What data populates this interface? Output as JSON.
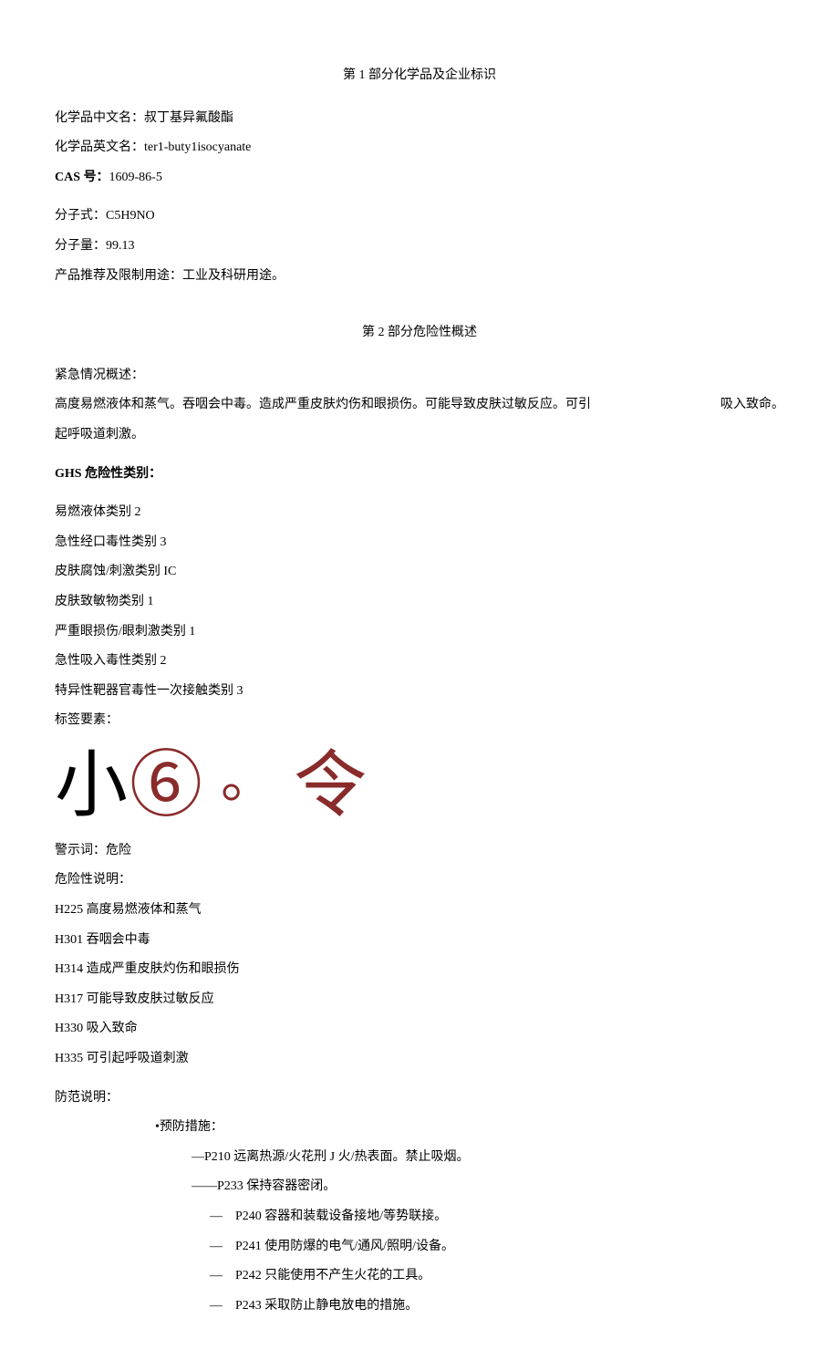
{
  "section1": {
    "title": "第 1 部分化学品及企业标识",
    "name_cn_label": "化学品中文名：",
    "name_cn_value": "叔丁基异氟酸酯",
    "name_en_label": "化学品英文名：",
    "name_en_value": "ter1-buty1isocyanate",
    "cas_label": "CAS 号：",
    "cas_value": "1609-86-5",
    "formula_label": "分子式：",
    "formula_value": "C5H9NO",
    "mw_label": "分子量：",
    "mw_value": "99.13",
    "use_label": "产品推荐及限制用途：",
    "use_value": "工业及科研用途。"
  },
  "section2": {
    "title": "第 2 部分危险性概述",
    "emergency_label": "紧急情况概述：",
    "emergency_text_left": "高度易燃液体和蒸气。吞咽会中毒。造成严重皮肤灼伤和眼损伤。可能导致皮肤过敏反应。可引",
    "emergency_text_right": "吸入致命。",
    "emergency_text_line2": "起呼吸道刺激。",
    "ghs_label": "GHS 危险性类别：",
    "ghs_classes": [
      "易燃液体类别 2",
      "急性经口毒性类别 3",
      "皮肤腐蚀/刺激类别 IC",
      "皮肤致敏物类别 1",
      "严重眼损伤/眼刺激类别 1",
      "急性吸入毒性类别 2",
      "特异性靶器官毒性一次接触类别 3"
    ],
    "label_elements": "标签要素：",
    "pictograms": {
      "p1": "小",
      "p2": "⑥",
      "p3": "。",
      "p4": "令"
    },
    "signal_label": "警示词：",
    "signal_value": "危险",
    "hazard_label": "危险性说明：",
    "hazard_statements": [
      "H225 高度易燃液体和蒸气",
      "H301 吞咽会中毒",
      "H314 造成严重皮肤灼伤和眼损伤",
      "H317 可能导致皮肤过敏反应",
      "H330 吸入致命",
      "H335 可引起呼吸道刺激"
    ],
    "precaution_label": "防范说明：",
    "prevention_header": "•预防措施：",
    "prevention_items": [
      {
        "prefix": "—",
        "text": "P210 远离热源/火花刑 J 火/热表面。禁止吸烟。"
      },
      {
        "prefix": "——",
        "text": "P233 保持容器密闭。"
      },
      {
        "prefix": "—　",
        "text": "P240 容器和装载设备接地/等势联接。"
      },
      {
        "prefix": "—　",
        "text": "P241 使用防爆的电气/通风/照明/设备。"
      },
      {
        "prefix": "—　",
        "text": "P242 只能使用不产生火花的工具。"
      },
      {
        "prefix": "—　",
        "text": "P243 采取防止静电放电的措施。"
      }
    ]
  }
}
